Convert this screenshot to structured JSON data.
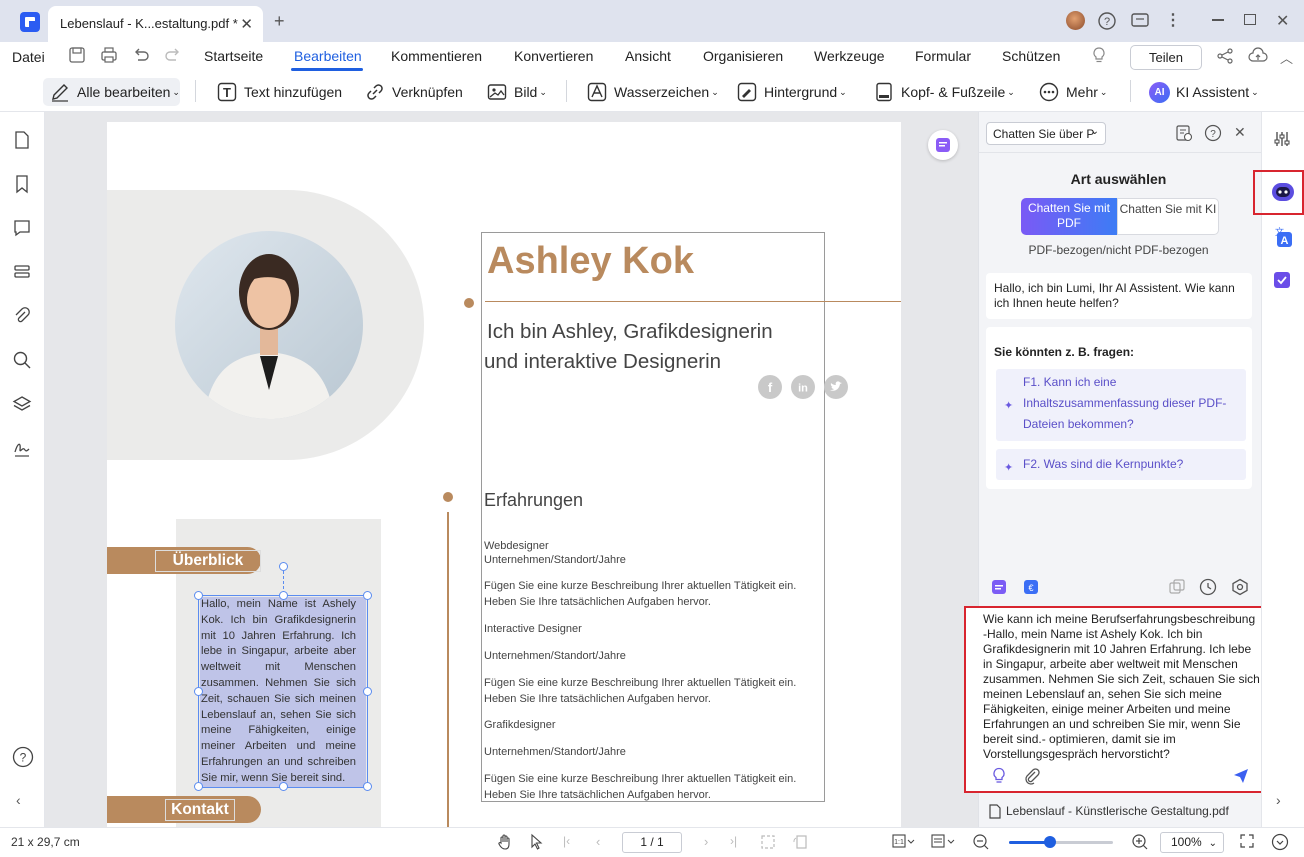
{
  "tab": {
    "title": "Lebenslauf - K...estaltung.pdf *"
  },
  "menu": {
    "file": "Datei",
    "items": [
      "Startseite",
      "Bearbeiten",
      "Kommentieren",
      "Konvertieren",
      "Ansicht",
      "Organisieren",
      "Werkzeuge",
      "Formular",
      "Schützen"
    ],
    "share": "Teilen"
  },
  "toolbar": {
    "edit_all": "Alle bearbeiten",
    "add_text": "Text hinzufügen",
    "link": "Verknüpfen",
    "image": "Bild",
    "watermark": "Wasserzeichen",
    "background": "Hintergrund",
    "header_footer": "Kopf- & Fußzeile",
    "more": "Mehr",
    "ai_assistant": "KI Assistent",
    "ai_badge": "AI"
  },
  "page": {
    "name": "Ashley Kok",
    "subtitle_line1": "Ich bin Ashley, Grafikdesignerin",
    "subtitle_line2": "und interaktive Designerin",
    "section_overview": "Überblick",
    "section_contact": "Kontakt",
    "overview_text": "Hallo, mein Name ist Ashely Kok. Ich bin Grafikdesignerin mit 10 Jahren Erfahrung. Ich lebe in Singapur, arbeite aber weltweit mit Menschen zusammen. Nehmen Sie sich Zeit, schauen Sie sich meinen Lebenslauf an, sehen Sie sich meine Fähigkeiten, einige meiner Arbeiten und meine Erfahrungen an und schreiben Sie mir, wenn Sie bereit sind.",
    "experience_title": "Erfahrungen",
    "exp": [
      "Webdesigner",
      "Unternehmen/Standort/Jahre",
      "Fügen Sie eine kurze Beschreibung Ihrer aktuellen Tätigkeit ein.",
      "Heben Sie Ihre tatsächlichen Aufgaben hervor.",
      "Interactive Designer",
      "Unternehmen/Standort/Jahre",
      "Fügen Sie eine kurze Beschreibung Ihrer aktuellen Tätigkeit ein.",
      "Heben Sie Ihre tatsächlichen Aufgaben hervor.",
      "Grafikdesigner",
      "Unternehmen/Standort/Jahre",
      "Fügen Sie eine kurze Beschreibung Ihrer aktuellen Tätigkeit ein.",
      "Heben Sie Ihre tatsächlichen Aufgaben hervor."
    ]
  },
  "panel": {
    "chat_select": "Chatten Sie über P",
    "type_title": "Art auswählen",
    "seg_pdf": "Chatten Sie mit PDF",
    "seg_ki": "Chatten Sie mit KI",
    "type_sub": "PDF-bezogen/nicht PDF-bezogen",
    "greeting": "Hallo, ich bin Lumi, Ihr AI Assistent. Wie kann ich Ihnen heute helfen?",
    "ask_title": "Sie könnten z. B. fragen:",
    "q1": "F1. Kann ich eine Inhaltszusammenfassung dieser PDF-Dateien bekommen?",
    "q2": "F2. Was sind die Kernpunkte?",
    "input": "Wie kann ich meine Berufserfahrungsbeschreibung  -Hallo, mein Name ist Ashely Kok. Ich bin Grafikdesignerin mit 10 Jahren Erfahrung. Ich lebe in Singapur, arbeite aber weltweit mit Menschen zusammen. Nehmen Sie sich Zeit, schauen Sie sich meinen Lebenslauf an, sehen Sie sich meine Fähigkeiten, einige meiner Arbeiten und meine Erfahrungen an und schreiben Sie mir, wenn Sie bereit sind.- optimieren, damit sie im Vorstellungsgespräch hervorsticht?",
    "file": "Lebenslauf - Künstlerische Gestaltung.pdf"
  },
  "status": {
    "size": "21 x 29,7 cm",
    "page": "1 / 1",
    "zoom": "100%",
    "zoom_fraction": 0.39
  },
  "colors": {
    "accent": "#1f5fe0",
    "brown": "#b98a5e",
    "alert": "#d8252f"
  }
}
